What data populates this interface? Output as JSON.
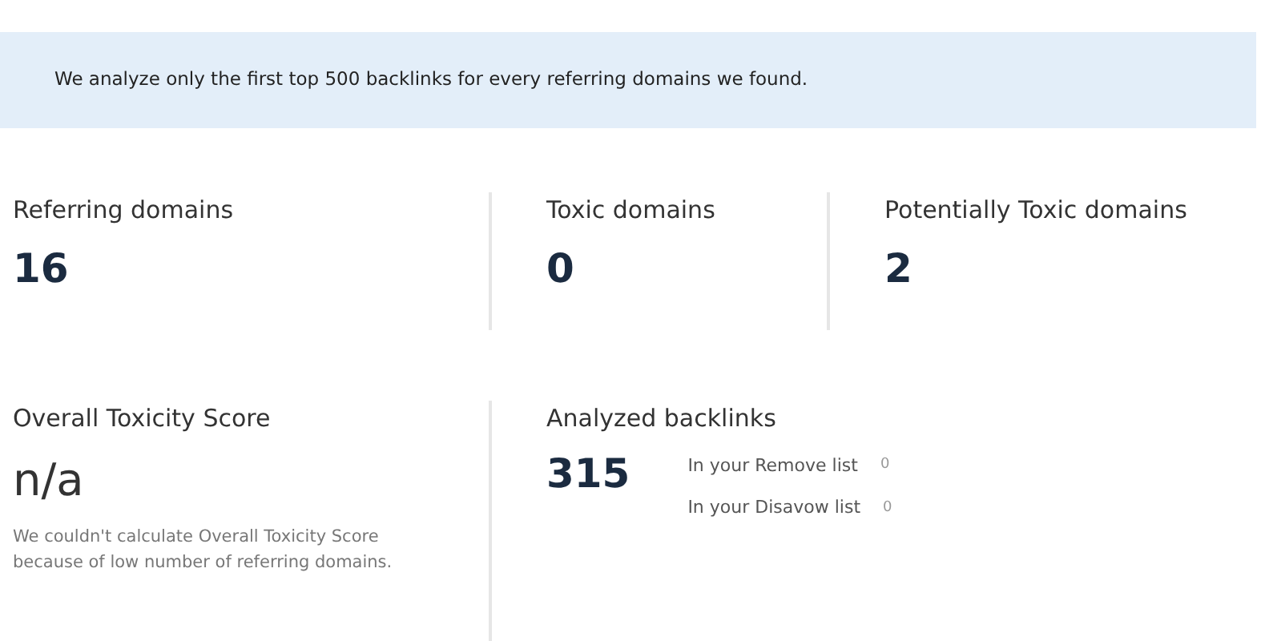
{
  "notice": "We analyze only the first top 500 backlinks for every referring domains we found.",
  "stats": [
    {
      "label": "Referring domains",
      "value": "16"
    },
    {
      "label": "Toxic domains",
      "value": "0"
    },
    {
      "label": "Potentially Toxic domains",
      "value": "2"
    }
  ],
  "toxicity": {
    "label": "Overall Toxicity Score",
    "value": "n/a",
    "note": "We couldn't calculate Overall Toxicity Score because of low number of referring domains."
  },
  "backlinks": {
    "label": "Analyzed backlinks",
    "value": "315",
    "lists": [
      {
        "label": "In your Remove list",
        "count": "0"
      },
      {
        "label": "In your Disavow list",
        "count": "0"
      }
    ]
  }
}
